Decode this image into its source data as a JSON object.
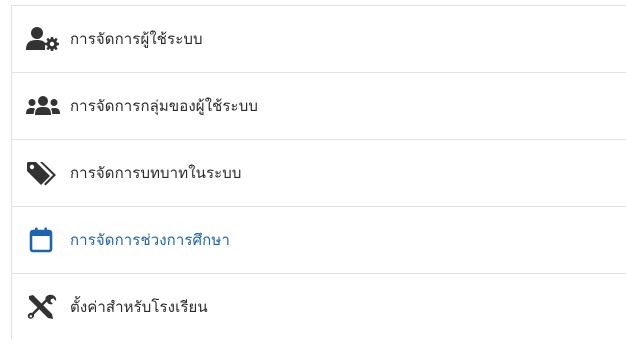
{
  "menu": {
    "items": [
      {
        "label": "การจัดการผู้ใช้ระบบ",
        "icon": "user-cog-icon"
      },
      {
        "label": "การจัดการกลุ่มของผู้ใช้ระบบ",
        "icon": "users-icon"
      },
      {
        "label": "การจัดการบทบาทในระบบ",
        "icon": "tags-icon"
      },
      {
        "label": "การจัดการช่วงการศึกษา",
        "icon": "calendar-icon",
        "active": true
      },
      {
        "label": "ตั้งค่าสำหรับโรงเรียน",
        "icon": "tools-icon"
      }
    ]
  },
  "colors": {
    "icon_default": "#333333",
    "active": "#1c64b3",
    "border": "#dfe3e8"
  }
}
